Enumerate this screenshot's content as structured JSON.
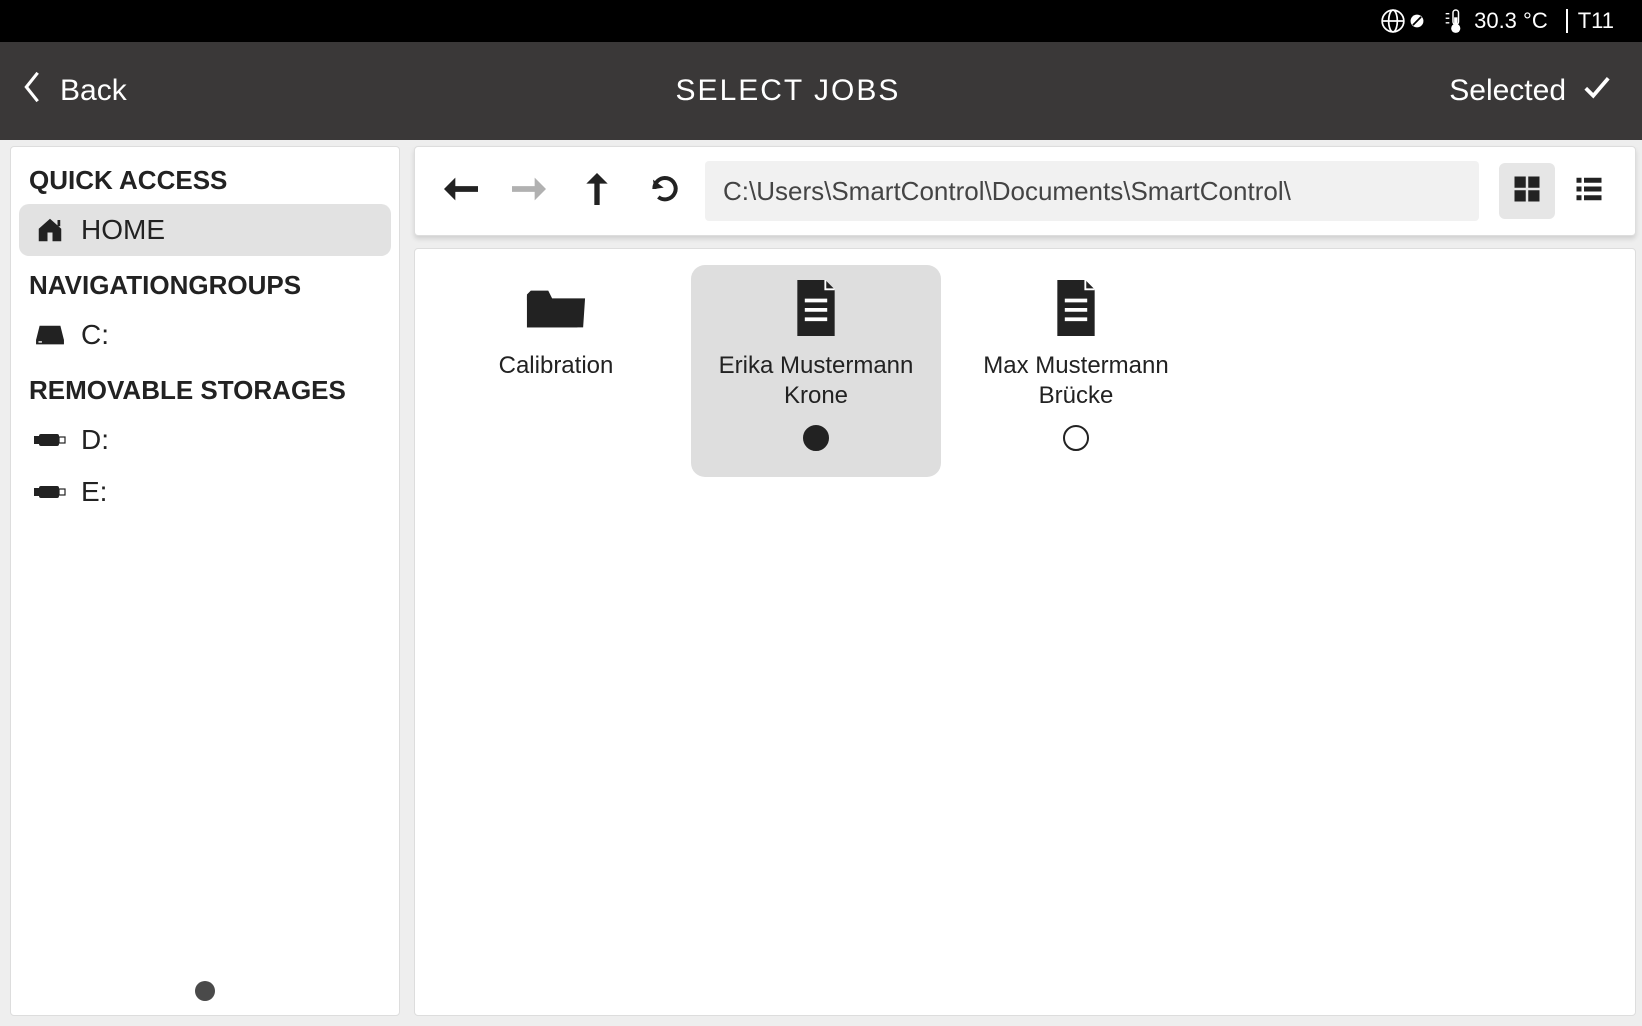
{
  "status": {
    "temperature": "30.3 °C",
    "slot": "T11"
  },
  "header": {
    "back_label": "Back",
    "title": "SELECT JOBS",
    "selected_label": "Selected"
  },
  "sidebar": {
    "quick_access_heading": "QUICK ACCESS",
    "home_label": "HOME",
    "nav_groups_heading": "NAVIGATIONGROUPS",
    "drive_c_label": "C:",
    "removable_heading": "REMOVABLE STORAGES",
    "drive_d_label": "D:",
    "drive_e_label": "E:"
  },
  "toolbar": {
    "path": "C:\\Users\\SmartControl\\Documents\\SmartControl\\"
  },
  "files": {
    "item0": {
      "label": "Calibration",
      "type": "folder",
      "selected": false
    },
    "item1": {
      "label": "Erika Mustermann Krone",
      "type": "file",
      "selected": true
    },
    "item2": {
      "label": "Max Mustermann Brücke",
      "type": "file",
      "selected": false
    }
  }
}
